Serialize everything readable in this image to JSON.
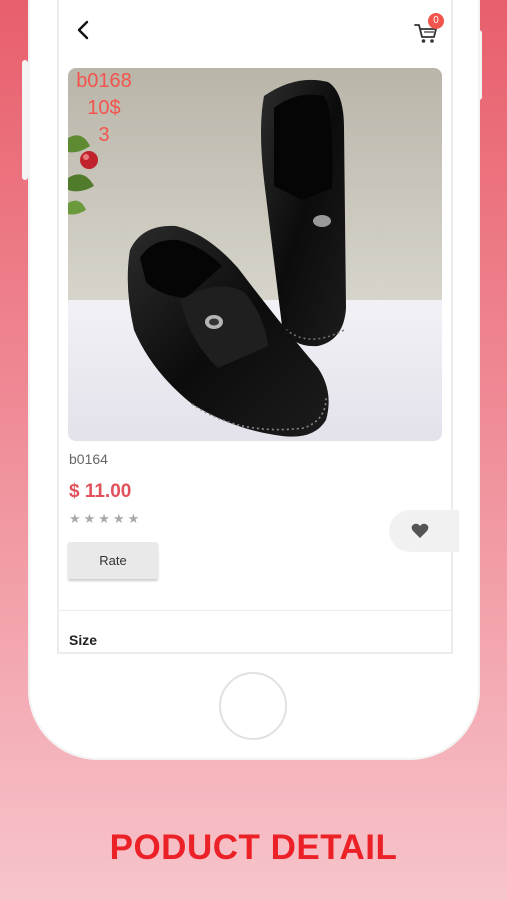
{
  "header": {
    "back_icon": "chevron-left-icon",
    "cart_icon": "cart-icon",
    "cart_count": "0"
  },
  "product": {
    "image_overlay": {
      "line1": "b0168",
      "line2": "10$",
      "line3": "3"
    },
    "sku": "b0164",
    "price": "$ 11.00",
    "stars": "★★★★★",
    "rating_out_of_5": 0,
    "rate_label": "Rate",
    "wishlist_icon": "heart-icon",
    "size_label": "Size"
  },
  "banner": {
    "title": "PODUCT DETAIL"
  },
  "colors": {
    "accent_red": "#e2525c",
    "banner_red": "#ec2027",
    "badge_red": "#f2544e"
  }
}
